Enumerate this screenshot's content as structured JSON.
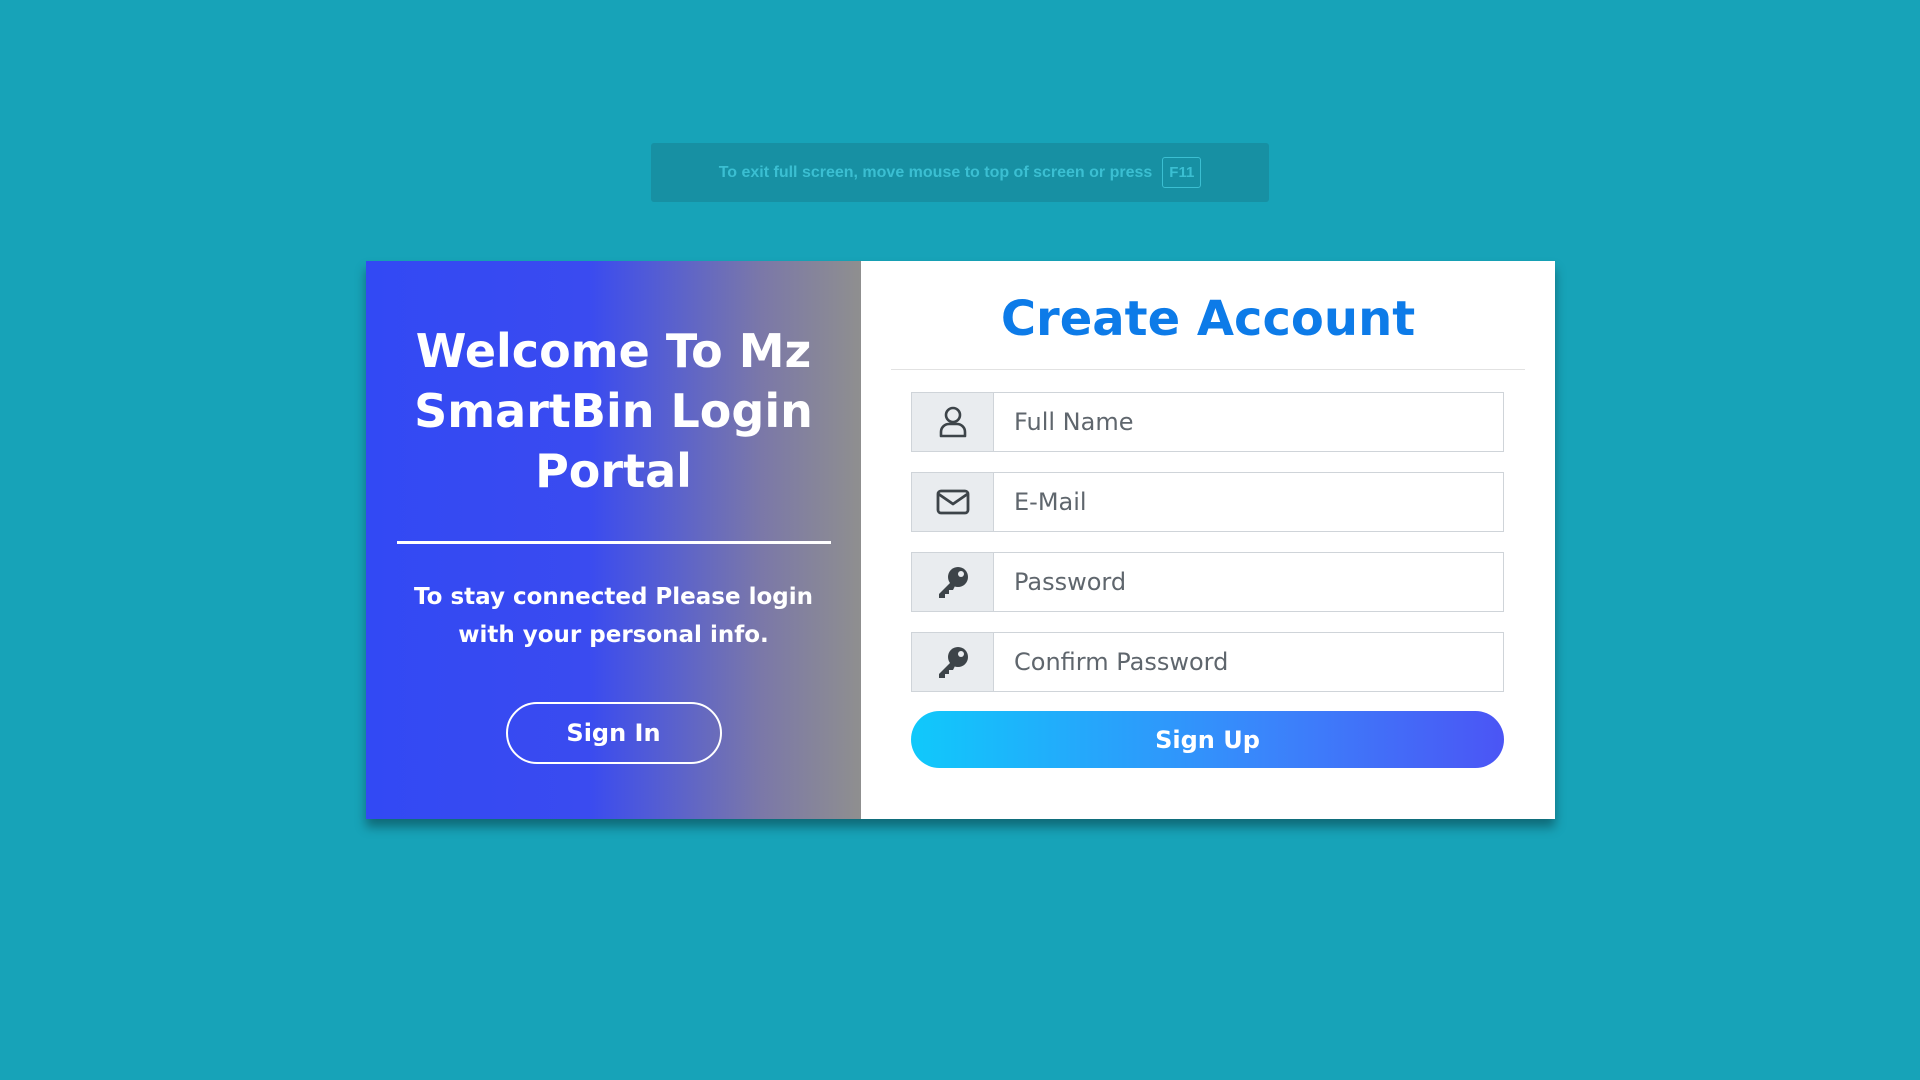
{
  "fullscreen_notice": {
    "message": "To exit full screen, move mouse to top of screen or press",
    "key": "F11"
  },
  "left_panel": {
    "title": "Welcome To Mz SmartBin Login Portal",
    "subtitle": "To stay connected Please login with your personal info.",
    "signin_label": "Sign In"
  },
  "form": {
    "title": "Create Account",
    "fields": [
      {
        "icon": "user-icon",
        "placeholder": "Full Name",
        "value": ""
      },
      {
        "icon": "envelope-icon",
        "placeholder": "E-Mail",
        "value": ""
      },
      {
        "icon": "key-icon",
        "placeholder": "Password",
        "value": ""
      },
      {
        "icon": "key-icon",
        "placeholder": "Confirm Password",
        "value": ""
      }
    ],
    "submit_label": "Sign Up"
  },
  "colors": {
    "page_background": "#17a3b8",
    "title_blue": "#0d7be8",
    "left_gradient_start": "#3249f4",
    "left_gradient_end": "#8f8f8f",
    "button_gradient_start": "#10c9fb",
    "button_gradient_end": "#4b55f5"
  }
}
